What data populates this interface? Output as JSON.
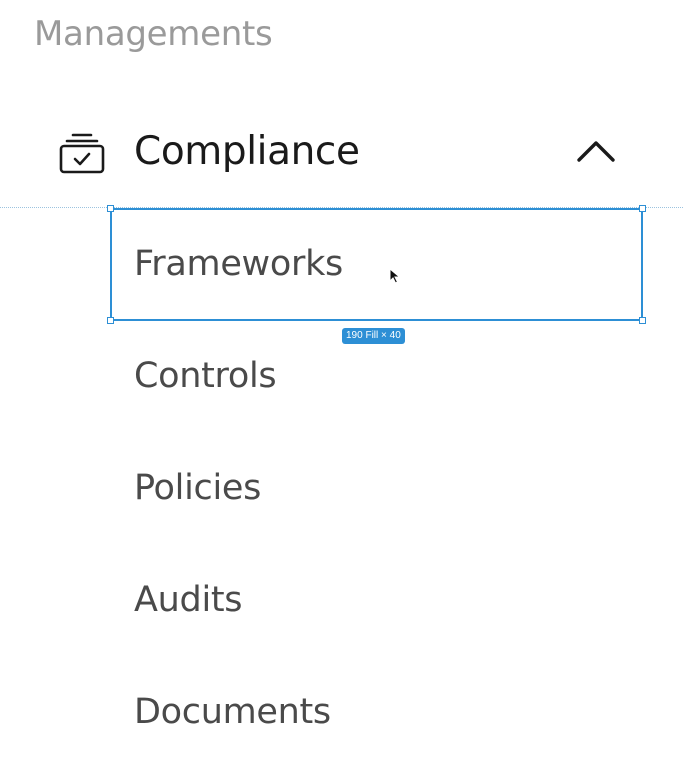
{
  "sidebar": {
    "section_title": "Managements",
    "group": {
      "label": "Compliance",
      "icon": "clipboard-check-icon",
      "expanded": true,
      "chevron_icon": "chevron-up-icon"
    },
    "items": [
      {
        "label": "Frameworks",
        "selected": true
      },
      {
        "label": "Controls"
      },
      {
        "label": "Policies"
      },
      {
        "label": "Audits"
      },
      {
        "label": "Documents"
      }
    ]
  },
  "editor_overlay": {
    "size_label": "190 Fill × 40",
    "accent_color": "#2d8fd5"
  }
}
